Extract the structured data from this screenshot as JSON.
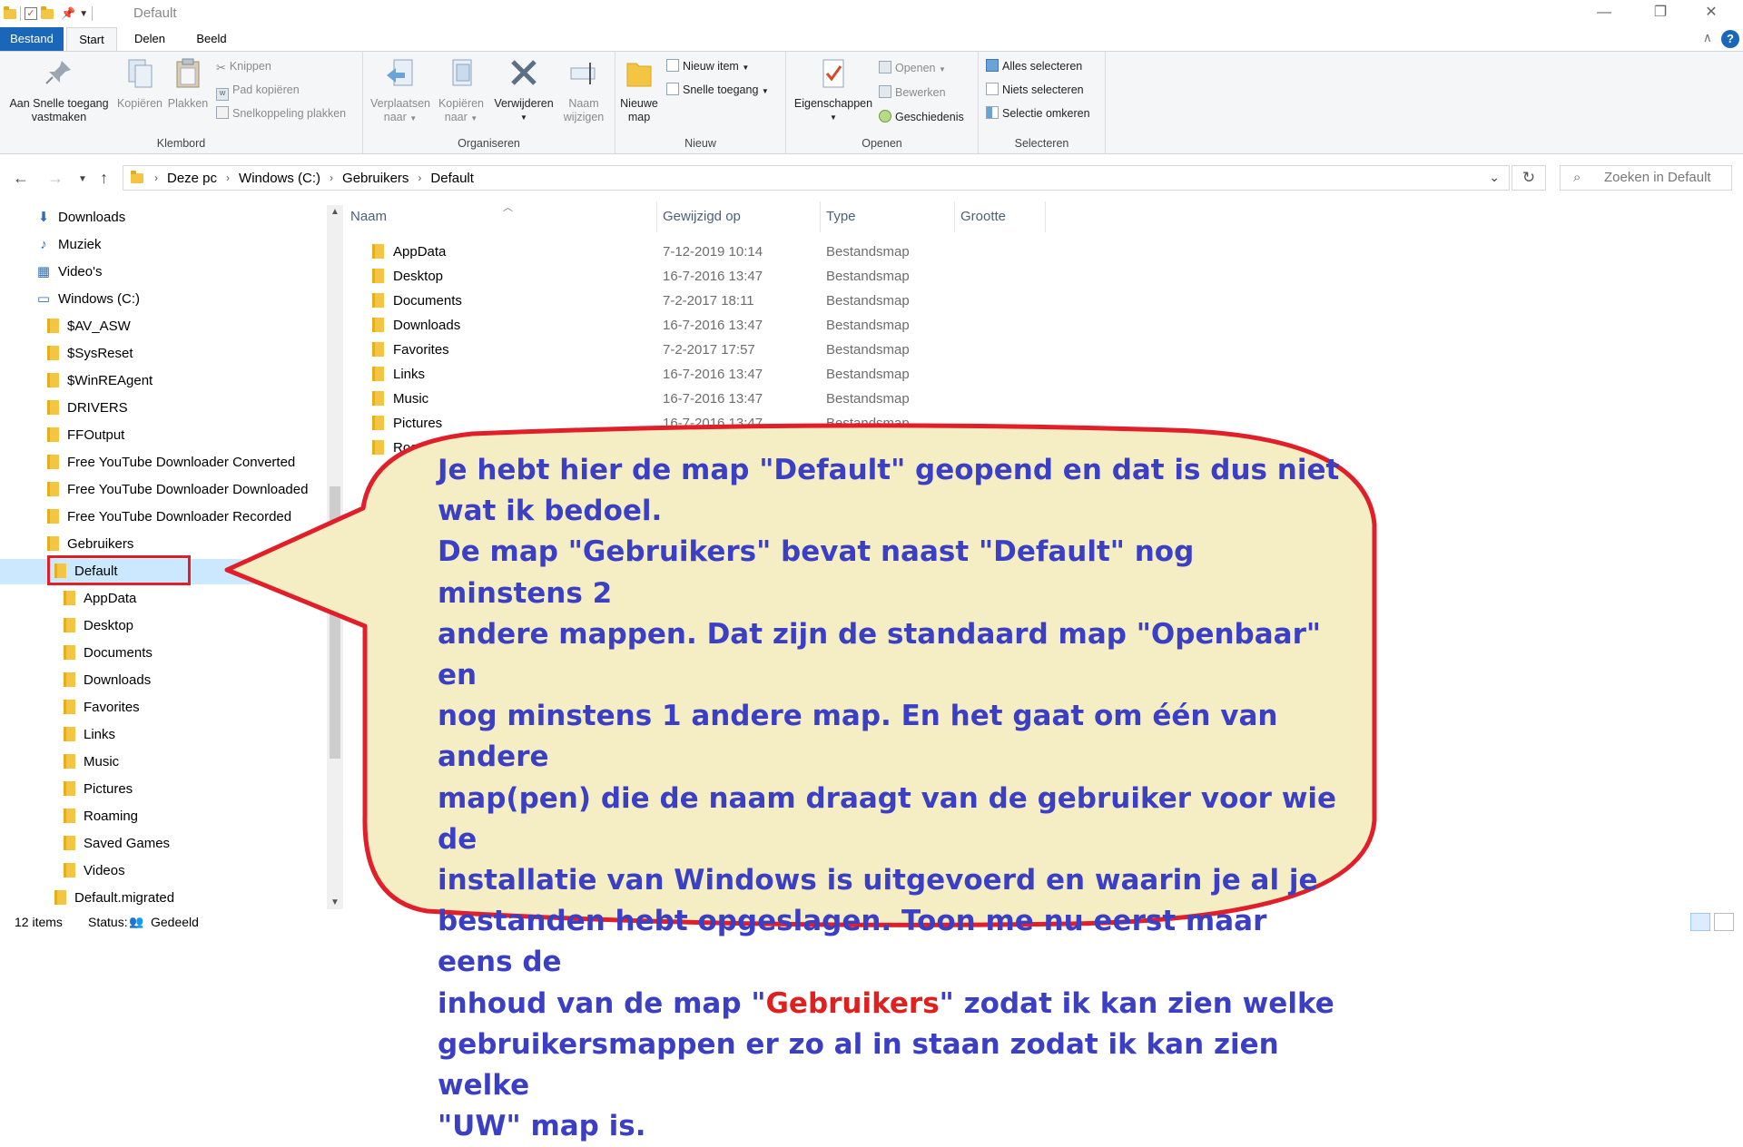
{
  "window": {
    "title": "Default",
    "controls": {
      "minimize": "—",
      "maximize": "❐",
      "close": "✕"
    }
  },
  "ribbon": {
    "tabs": [
      "Bestand",
      "Start",
      "Delen",
      "Beeld"
    ],
    "help": "?",
    "groups": {
      "klembord": {
        "label": "Klembord",
        "pin": "Aan Snelle toegang vastmaken",
        "pin_l1": "Aan Snelle toegang",
        "pin_l2": "vastmaken",
        "copy": "Kopiëren",
        "paste": "Plakken",
        "cut": "Knippen",
        "copy_path": "Pad kopiëren",
        "paste_shortcut": "Snelkoppeling plakken"
      },
      "organiseren": {
        "label": "Organiseren",
        "move_l1": "Verplaatsen",
        "move_l2": "naar",
        "copyto_l1": "Kopiëren",
        "copyto_l2": "naar",
        "delete": "Verwijderen",
        "rename_l1": "Naam",
        "rename_l2": "wijzigen"
      },
      "nieuw": {
        "label": "Nieuw",
        "new_folder_l1": "Nieuwe",
        "new_folder_l2": "map",
        "new_item": "Nieuw item",
        "easy_access": "Snelle toegang"
      },
      "openen": {
        "label": "Openen",
        "properties": "Eigenschappen",
        "open": "Openen",
        "edit": "Bewerken",
        "history": "Geschiedenis"
      },
      "selecteren": {
        "label": "Selecteren",
        "select_all": "Alles selecteren",
        "select_none": "Niets selecteren",
        "invert": "Selectie omkeren"
      }
    }
  },
  "address": {
    "crumbs": [
      "Deze pc",
      "Windows (C:)",
      "Gebruikers",
      "Default"
    ],
    "search_placeholder": "Zoeken in Default"
  },
  "nav": {
    "items": [
      {
        "label": "Downloads",
        "level": 0,
        "icon": "download-arrow-icon"
      },
      {
        "label": "Muziek",
        "level": 0,
        "icon": "music-note-icon"
      },
      {
        "label": "Video's",
        "level": 0,
        "icon": "film-icon"
      },
      {
        "label": "Windows (C:)",
        "level": 0,
        "icon": "drive-icon"
      },
      {
        "label": "$AV_ASW",
        "level": 1,
        "icon": "folder-icon"
      },
      {
        "label": "$SysReset",
        "level": 1,
        "icon": "folder-icon"
      },
      {
        "label": "$WinREAgent",
        "level": 1,
        "icon": "folder-icon"
      },
      {
        "label": "DRIVERS",
        "level": 1,
        "icon": "folder-icon"
      },
      {
        "label": "FFOutput",
        "level": 1,
        "icon": "folder-icon"
      },
      {
        "label": "Free YouTube Downloader Converted",
        "level": 1,
        "icon": "folder-icon"
      },
      {
        "label": "Free YouTube Downloader Downloaded",
        "level": 1,
        "icon": "folder-icon"
      },
      {
        "label": "Free YouTube Downloader Recorded",
        "level": 1,
        "icon": "folder-icon"
      },
      {
        "label": "Gebruikers",
        "level": 1,
        "icon": "folder-icon"
      },
      {
        "label": "Default",
        "level": 2,
        "icon": "folder-icon",
        "selected": true
      },
      {
        "label": "AppData",
        "level": 3,
        "icon": "folder-icon"
      },
      {
        "label": "Desktop",
        "level": 3,
        "icon": "folder-icon"
      },
      {
        "label": "Documents",
        "level": 3,
        "icon": "folder-icon"
      },
      {
        "label": "Downloads",
        "level": 3,
        "icon": "folder-icon"
      },
      {
        "label": "Favorites",
        "level": 3,
        "icon": "folder-icon"
      },
      {
        "label": "Links",
        "level": 3,
        "icon": "folder-icon"
      },
      {
        "label": "Music",
        "level": 3,
        "icon": "folder-icon"
      },
      {
        "label": "Pictures",
        "level": 3,
        "icon": "folder-icon"
      },
      {
        "label": "Roaming",
        "level": 3,
        "icon": "folder-icon"
      },
      {
        "label": "Saved Games",
        "level": 3,
        "icon": "folder-icon"
      },
      {
        "label": "Videos",
        "level": 3,
        "icon": "folder-icon"
      },
      {
        "label": "Default.migrated",
        "level": 2,
        "icon": "folder-icon"
      }
    ]
  },
  "filelist": {
    "columns": [
      "Naam",
      "Gewijzigd op",
      "Type",
      "Grootte"
    ],
    "rows": [
      {
        "name": "AppData",
        "date": "7-12-2019 10:14",
        "type": "Bestandsmap"
      },
      {
        "name": "Desktop",
        "date": "16-7-2016 13:47",
        "type": "Bestandsmap"
      },
      {
        "name": "Documents",
        "date": "7-2-2017 18:11",
        "type": "Bestandsmap"
      },
      {
        "name": "Downloads",
        "date": "16-7-2016 13:47",
        "type": "Bestandsmap"
      },
      {
        "name": "Favorites",
        "date": "7-2-2017 17:57",
        "type": "Bestandsmap"
      },
      {
        "name": "Links",
        "date": "16-7-2016 13:47",
        "type": "Bestandsmap"
      },
      {
        "name": "Music",
        "date": "16-7-2016 13:47",
        "type": "Bestandsmap"
      },
      {
        "name": "Pictures",
        "date": "16-7-2016 13:47",
        "type": "Bestandsmap"
      },
      {
        "name": "Roaming",
        "date": "",
        "type": ""
      }
    ]
  },
  "status": {
    "count": "12 items",
    "state_label": "Status:",
    "state_value": "Gedeeld"
  },
  "callout": {
    "text_before": "Je hebt hier de map \"Default\" geopend en dat is dus niet\nwat ik bedoel.\nDe map \"Gebruikers\" bevat naast \"Default\" nog minstens 2\nandere mappen. Dat zijn de standaard map \"Openbaar\" en\nnog minstens 1 andere map. En het gaat om één van andere\nmap(pen) die de naam draagt van de gebruiker voor wie de\ninstallatie van Windows is uitgevoerd en waarin je al je\nbestanden hebt opgeslagen. Toon me nu eerst maar eens de\ninhoud van de map \"",
    "highlight": "Gebruikers",
    "text_after": "\" zodat ik kan zien welke\ngebruikersmappen er zo al in staan zodat ik kan zien welke\n\"UW\" map is.",
    "colors": {
      "text": "#3b3fc4",
      "highlight": "#e01f1f",
      "border": "#e01f2a",
      "fill": "#f5eec4"
    }
  },
  "colors": {
    "accent": "#1a66b8",
    "selection": "#cce8ff",
    "folder": "#f4c542"
  }
}
